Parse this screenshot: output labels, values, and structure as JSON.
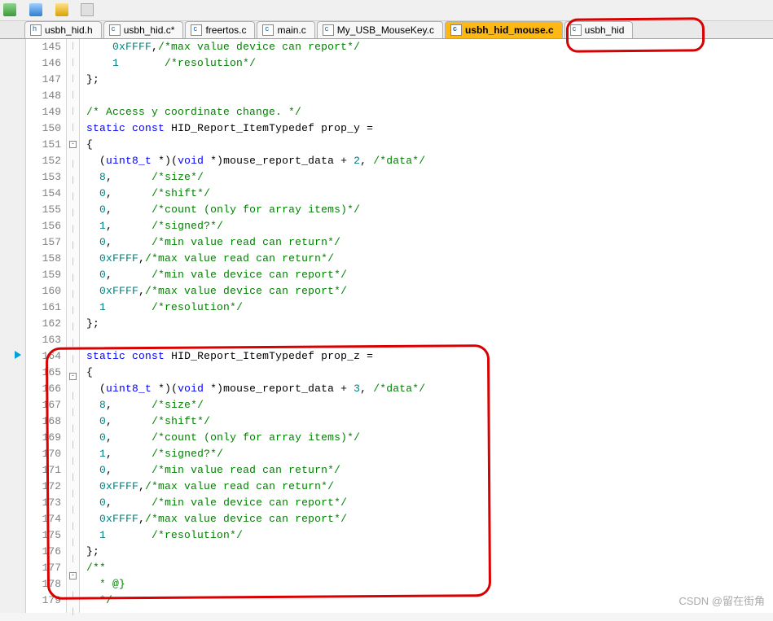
{
  "toolbar": {
    "icons": [
      "back",
      "forward",
      "save",
      "undo",
      "redo"
    ]
  },
  "tabs": [
    {
      "label": "usbh_hid.h",
      "icon": "h",
      "active": false
    },
    {
      "label": "usbh_hid.c*",
      "icon": "c",
      "active": false
    },
    {
      "label": "freertos.c",
      "icon": "c",
      "active": false
    },
    {
      "label": "main.c",
      "icon": "c",
      "active": false
    },
    {
      "label": "My_USB_MouseKey.c",
      "icon": "c",
      "active": false
    },
    {
      "label": "usbh_hid_mouse.c",
      "icon": "c",
      "active": true
    },
    {
      "label": "usbh_hid",
      "icon": "c",
      "active": false
    }
  ],
  "lines": {
    "145": {
      "tokens": [
        [
          "",
          "    "
        ],
        [
          "num",
          "0xFFFF"
        ],
        [
          "punc",
          ","
        ],
        [
          "cmt",
          "/*max value device can report*/"
        ]
      ]
    },
    "146": {
      "tokens": [
        [
          "",
          "    "
        ],
        [
          "num",
          "1"
        ],
        [
          "",
          "       "
        ],
        [
          "cmt",
          "/*resolution*/"
        ]
      ]
    },
    "147": {
      "tokens": [
        [
          "punc",
          "};"
        ]
      ]
    },
    "148": {
      "tokens": []
    },
    "149": {
      "tokens": [
        [
          "cmt",
          "/* Access y coordinate change. */"
        ]
      ]
    },
    "150": {
      "tokens": [
        [
          "kw",
          "static"
        ],
        [
          "",
          " "
        ],
        [
          "kw",
          "const"
        ],
        [
          "",
          " "
        ],
        [
          "ident",
          "HID_Report_ItemTypedef prop_y ="
        ]
      ]
    },
    "151": {
      "tokens": [
        [
          "punc",
          "{"
        ]
      ],
      "fold": "-"
    },
    "152": {
      "tokens": [
        [
          "",
          "  "
        ],
        [
          "punc",
          "("
        ],
        [
          "kw",
          "uint8_t"
        ],
        [
          "",
          " "
        ],
        [
          "punc",
          "*)("
        ],
        [
          "kw",
          "void"
        ],
        [
          "",
          " "
        ],
        [
          "punc",
          "*)"
        ],
        [
          "ident",
          "mouse_report_data + "
        ],
        [
          "num",
          "2"
        ],
        [
          "punc",
          ", "
        ],
        [
          "cmt",
          "/*data*/"
        ]
      ]
    },
    "153": {
      "tokens": [
        [
          "",
          "  "
        ],
        [
          "num",
          "8"
        ],
        [
          "punc",
          ","
        ],
        [
          "",
          "      "
        ],
        [
          "cmt",
          "/*size*/"
        ]
      ]
    },
    "154": {
      "tokens": [
        [
          "",
          "  "
        ],
        [
          "num",
          "0"
        ],
        [
          "punc",
          ","
        ],
        [
          "",
          "      "
        ],
        [
          "cmt",
          "/*shift*/"
        ]
      ]
    },
    "155": {
      "tokens": [
        [
          "",
          "  "
        ],
        [
          "num",
          "0"
        ],
        [
          "punc",
          ","
        ],
        [
          "",
          "      "
        ],
        [
          "cmt",
          "/*count (only for array items)*/"
        ]
      ]
    },
    "156": {
      "tokens": [
        [
          "",
          "  "
        ],
        [
          "num",
          "1"
        ],
        [
          "punc",
          ","
        ],
        [
          "",
          "      "
        ],
        [
          "cmt",
          "/*signed?*/"
        ]
      ]
    },
    "157": {
      "tokens": [
        [
          "",
          "  "
        ],
        [
          "num",
          "0"
        ],
        [
          "punc",
          ","
        ],
        [
          "",
          "      "
        ],
        [
          "cmt",
          "/*min value read can return*/"
        ]
      ]
    },
    "158": {
      "tokens": [
        [
          "",
          "  "
        ],
        [
          "num",
          "0xFFFF"
        ],
        [
          "punc",
          ","
        ],
        [
          "cmt",
          "/*max value read can return*/"
        ]
      ]
    },
    "159": {
      "tokens": [
        [
          "",
          "  "
        ],
        [
          "num",
          "0"
        ],
        [
          "punc",
          ","
        ],
        [
          "",
          "      "
        ],
        [
          "cmt",
          "/*min vale device can report*/"
        ]
      ]
    },
    "160": {
      "tokens": [
        [
          "",
          "  "
        ],
        [
          "num",
          "0xFFFF"
        ],
        [
          "punc",
          ","
        ],
        [
          "cmt",
          "/*max value device can report*/"
        ]
      ]
    },
    "161": {
      "tokens": [
        [
          "",
          "  "
        ],
        [
          "num",
          "1"
        ],
        [
          "",
          "       "
        ],
        [
          "cmt",
          "/*resolution*/"
        ]
      ]
    },
    "162": {
      "tokens": [
        [
          "punc",
          "};"
        ]
      ]
    },
    "163": {
      "tokens": []
    },
    "164": {
      "tokens": [
        [
          "kw",
          "static"
        ],
        [
          "",
          " "
        ],
        [
          "kw",
          "const"
        ],
        [
          "",
          " "
        ],
        [
          "ident",
          "HID_Report_ItemTypedef prop_z ="
        ]
      ]
    },
    "165": {
      "tokens": [
        [
          "punc",
          "{"
        ]
      ],
      "fold": "-"
    },
    "166": {
      "tokens": [
        [
          "",
          "  "
        ],
        [
          "punc",
          "("
        ],
        [
          "kw",
          "uint8_t"
        ],
        [
          "",
          " "
        ],
        [
          "punc",
          "*)("
        ],
        [
          "kw",
          "void"
        ],
        [
          "",
          " "
        ],
        [
          "punc",
          "*)"
        ],
        [
          "ident",
          "mouse_report_data + "
        ],
        [
          "num",
          "3"
        ],
        [
          "punc",
          ", "
        ],
        [
          "cmt",
          "/*data*/"
        ]
      ]
    },
    "167": {
      "tokens": [
        [
          "",
          "  "
        ],
        [
          "num",
          "8"
        ],
        [
          "punc",
          ","
        ],
        [
          "",
          "      "
        ],
        [
          "cmt",
          "/*size*/"
        ]
      ]
    },
    "168": {
      "tokens": [
        [
          "",
          "  "
        ],
        [
          "num",
          "0"
        ],
        [
          "punc",
          ","
        ],
        [
          "",
          "      "
        ],
        [
          "cmt",
          "/*shift*/"
        ]
      ]
    },
    "169": {
      "tokens": [
        [
          "",
          "  "
        ],
        [
          "num",
          "0"
        ],
        [
          "punc",
          ","
        ],
        [
          "",
          "      "
        ],
        [
          "cmt",
          "/*count (only for array items)*/"
        ]
      ]
    },
    "170": {
      "tokens": [
        [
          "",
          "  "
        ],
        [
          "num",
          "1"
        ],
        [
          "punc",
          ","
        ],
        [
          "",
          "      "
        ],
        [
          "cmt",
          "/*signed?*/"
        ]
      ]
    },
    "171": {
      "tokens": [
        [
          "",
          "  "
        ],
        [
          "num",
          "0"
        ],
        [
          "punc",
          ","
        ],
        [
          "",
          "      "
        ],
        [
          "cmt",
          "/*min value read can return*/"
        ]
      ]
    },
    "172": {
      "tokens": [
        [
          "",
          "  "
        ],
        [
          "num",
          "0xFFFF"
        ],
        [
          "punc",
          ","
        ],
        [
          "cmt",
          "/*max value read can return*/"
        ]
      ]
    },
    "173": {
      "tokens": [
        [
          "",
          "  "
        ],
        [
          "num",
          "0"
        ],
        [
          "punc",
          ","
        ],
        [
          "",
          "      "
        ],
        [
          "cmt",
          "/*min vale device can report*/"
        ]
      ]
    },
    "174": {
      "tokens": [
        [
          "",
          "  "
        ],
        [
          "num",
          "0xFFFF"
        ],
        [
          "punc",
          ","
        ],
        [
          "cmt",
          "/*max value device can report*/"
        ]
      ]
    },
    "175": {
      "tokens": [
        [
          "",
          "  "
        ],
        [
          "num",
          "1"
        ],
        [
          "",
          "       "
        ],
        [
          "cmt",
          "/*resolution*/"
        ]
      ]
    },
    "176": {
      "tokens": [
        [
          "punc",
          "};"
        ]
      ]
    },
    "177": {
      "tokens": [
        [
          "cmt",
          "/**"
        ]
      ],
      "fold": "-"
    },
    "178": {
      "tokens": [
        [
          "cmt",
          "  * @}"
        ]
      ]
    },
    "179": {
      "tokens": [
        [
          "cmt",
          "  */"
        ]
      ]
    }
  },
  "firstLine": 145,
  "lastLine": 179,
  "watermark": "CSDN @留在街角"
}
